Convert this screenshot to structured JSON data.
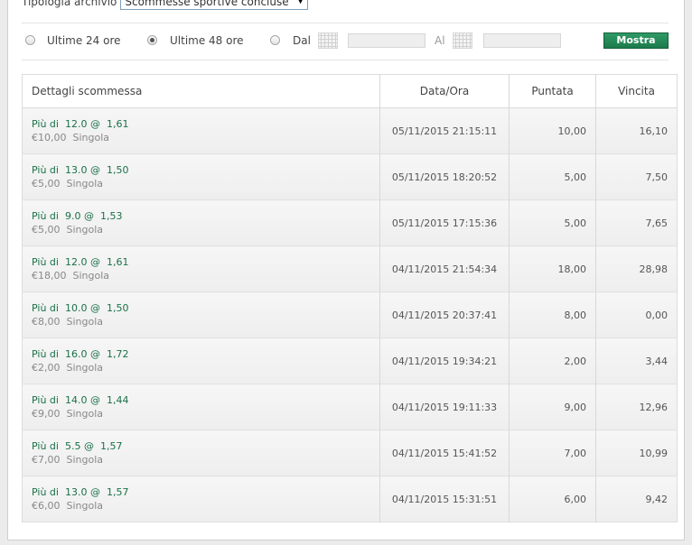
{
  "filters": {
    "archive_label": "Tipologia archivio",
    "archive_value": "Scommesse sportive concluse",
    "period_options": [
      {
        "label": "Ultime 24 ore",
        "checked": false
      },
      {
        "label": "Ultime 48 ore",
        "checked": true
      }
    ],
    "from_label": "Dal",
    "to_label": "Al",
    "submit_label": "Mostra"
  },
  "table": {
    "columns": [
      "Dettagli scommessa",
      "Data/Ora",
      "Puntata",
      "Vincita"
    ],
    "rows": [
      {
        "market": "Più di",
        "line": "12.0",
        "at": "@",
        "odds": "1,61",
        "stake_eur": "€10,00",
        "type": "Singola",
        "datetime": "05/11/2015 21:15:11",
        "stake": "10,00",
        "win": "16,10"
      },
      {
        "market": "Più di",
        "line": "13.0",
        "at": "@",
        "odds": "1,50",
        "stake_eur": "€5,00",
        "type": "Singola",
        "datetime": "05/11/2015 18:20:52",
        "stake": "5,00",
        "win": "7,50"
      },
      {
        "market": "Più di",
        "line": "9.0",
        "at": "@",
        "odds": "1,53",
        "stake_eur": "€5,00",
        "type": "Singola",
        "datetime": "05/11/2015 17:15:36",
        "stake": "5,00",
        "win": "7,65"
      },
      {
        "market": "Più di",
        "line": "12.0",
        "at": "@",
        "odds": "1,61",
        "stake_eur": "€18,00",
        "type": "Singola",
        "datetime": "04/11/2015 21:54:34",
        "stake": "18,00",
        "win": "28,98"
      },
      {
        "market": "Più di",
        "line": "10.0",
        "at": "@",
        "odds": "1,50",
        "stake_eur": "€8,00",
        "type": "Singola",
        "datetime": "04/11/2015 20:37:41",
        "stake": "8,00",
        "win": "0,00"
      },
      {
        "market": "Più di",
        "line": "16.0",
        "at": "@",
        "odds": "1,72",
        "stake_eur": "€2,00",
        "type": "Singola",
        "datetime": "04/11/2015 19:34:21",
        "stake": "2,00",
        "win": "3,44"
      },
      {
        "market": "Più di",
        "line": "14.0",
        "at": "@",
        "odds": "1,44",
        "stake_eur": "€9,00",
        "type": "Singola",
        "datetime": "04/11/2015 19:11:33",
        "stake": "9,00",
        "win": "12,96"
      },
      {
        "market": "Più di",
        "line": "5.5",
        "at": "@",
        "odds": "1,57",
        "stake_eur": "€7,00",
        "type": "Singola",
        "datetime": "04/11/2015 15:41:52",
        "stake": "7,00",
        "win": "10,99"
      },
      {
        "market": "Più di",
        "line": "13.0",
        "at": "@",
        "odds": "1,57",
        "stake_eur": "€6,00",
        "type": "Singola",
        "datetime": "04/11/2015 15:31:51",
        "stake": "6,00",
        "win": "9,42"
      }
    ]
  },
  "colors": {
    "accent": "#1c7a4b",
    "selection_text": "#1a7048"
  },
  "icons": {
    "date_picker": "calendar-icon",
    "select_arrow": "caret-down-icon"
  }
}
